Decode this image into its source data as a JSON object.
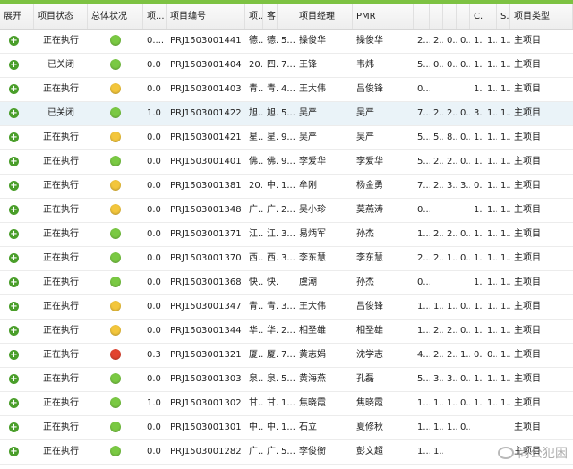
{
  "colors": {
    "top_bar": "#7dc242",
    "status_green": "#7ac943",
    "status_yellow": "#f3c63c",
    "status_red": "#e2432f",
    "expand_green": "#4a9e2a"
  },
  "columns": [
    "展开",
    "项目状态",
    "总体状况",
    "项...",
    "项目编号",
    "项...",
    "客...",
    "",
    "项目经理",
    "PMR",
    "",
    "",
    "",
    "",
    "C...",
    "",
    "S...",
    "项目类型"
  ],
  "rows": [
    {
      "status": "正在执行",
      "health": "green",
      "h": "0....",
      "code": "PRJ1503001441",
      "a": "德...",
      "b": "德...",
      "c": "5...",
      "mgr": "操俊华",
      "pmr": "操俊华",
      "d": "2...",
      "e": "2...",
      "f": "0...",
      "g": "0...",
      "h2": "1...",
      "i": "1...",
      "j": "1...",
      "type": "主项目"
    },
    {
      "status": "已关闭",
      "health": "green",
      "h": "0.0",
      "code": "PRJ1503001404",
      "a": "20...",
      "b": "四...",
      "c": "7...",
      "mgr": "王锋",
      "pmr": "韦炜",
      "d": "5...",
      "e": "0...",
      "f": "0...",
      "g": "0...",
      "h2": "1...",
      "i": "1...",
      "j": "1...",
      "type": "主项目"
    },
    {
      "status": "正在执行",
      "health": "yellow",
      "h": "0.0",
      "code": "PRJ1503001403",
      "a": "青...",
      "b": "青...",
      "c": "4...",
      "mgr": "王大伟",
      "pmr": "吕俊锋",
      "d": "0...",
      "e": "",
      "f": "",
      "g": "",
      "h2": "1...",
      "i": "1...",
      "j": "1...",
      "type": "主项目"
    },
    {
      "status": "已关闭",
      "health": "green",
      "h": "1.0",
      "code": "PRJ1503001422",
      "a": "旭...",
      "b": "旭...",
      "c": "5...",
      "mgr": "吴严",
      "pmr": "吴严",
      "d": "7...",
      "e": "2...",
      "f": "2...",
      "g": "0...",
      "h2": "3...",
      "i": "1...",
      "j": "1...",
      "type": "主项目",
      "sel": true
    },
    {
      "status": "正在执行",
      "health": "yellow",
      "h": "0.0",
      "code": "PRJ1503001421",
      "a": "星...",
      "b": "星...",
      "c": "9...",
      "mgr": "吴严",
      "pmr": "吴严",
      "d": "5...",
      "e": "5...",
      "f": "8...",
      "g": "0...",
      "h2": "1...",
      "i": "1...",
      "j": "1...",
      "type": "主项目"
    },
    {
      "status": "正在执行",
      "health": "green",
      "h": "0.0",
      "code": "PRJ1503001401",
      "a": "佛...",
      "b": "佛...",
      "c": "9...",
      "mgr": "李爱华",
      "pmr": "李爱华",
      "d": "5...",
      "e": "2...",
      "f": "2...",
      "g": "0...",
      "h2": "1...",
      "i": "1...",
      "j": "1...",
      "type": "主项目"
    },
    {
      "status": "正在执行",
      "health": "yellow",
      "h": "0.0",
      "code": "PRJ1503001381",
      "a": "20...",
      "b": "中...",
      "c": "1...",
      "mgr": "牟刚",
      "pmr": "杨金勇",
      "d": "7...",
      "e": "2...",
      "f": "3...",
      "g": "3...",
      "h2": "0...",
      "i": "1...",
      "j": "1...",
      "type": "主项目"
    },
    {
      "status": "正在执行",
      "health": "yellow",
      "h": "0.0",
      "code": "PRJ1503001348",
      "a": "广...",
      "b": "广...",
      "c": "2...",
      "mgr": "吴小珍",
      "pmr": "莫燕涛",
      "d": "0...",
      "e": "",
      "f": "",
      "g": "",
      "h2": "1...",
      "i": "1...",
      "j": "1...",
      "type": "主项目"
    },
    {
      "status": "正在执行",
      "health": "green",
      "h": "0.0",
      "code": "PRJ1503001371",
      "a": "江...",
      "b": "江...",
      "c": "3...",
      "mgr": "易炳军",
      "pmr": "孙杰",
      "d": "1...",
      "e": "2...",
      "f": "2...",
      "g": "0...",
      "h2": "1...",
      "i": "1...",
      "j": "1...",
      "type": "主项目"
    },
    {
      "status": "正在执行",
      "health": "green",
      "h": "0.0",
      "code": "PRJ1503001370",
      "a": "西...",
      "b": "西...",
      "c": "3...",
      "mgr": "李东慧",
      "pmr": "李东慧",
      "d": "2...",
      "e": "2...",
      "f": "1...",
      "g": "0...",
      "h2": "1...",
      "i": "1...",
      "j": "1...",
      "type": "主项目"
    },
    {
      "status": "正在执行",
      "health": "green",
      "h": "0.0",
      "code": "PRJ1503001368",
      "a": "快...",
      "b": "快...",
      "c": "",
      "mgr": "虞潮",
      "pmr": "孙杰",
      "d": "0...",
      "e": "",
      "f": "",
      "g": "",
      "h2": "1...",
      "i": "1...",
      "j": "1...",
      "type": "主项目"
    },
    {
      "status": "正在执行",
      "health": "yellow",
      "h": "0.0",
      "code": "PRJ1503001347",
      "a": "青...",
      "b": "青...",
      "c": "3...",
      "mgr": "王大伟",
      "pmr": "吕俊锋",
      "d": "1...",
      "e": "1...",
      "f": "1...",
      "g": "0...",
      "h2": "1...",
      "i": "1...",
      "j": "1...",
      "type": "主项目"
    },
    {
      "status": "正在执行",
      "health": "yellow",
      "h": "0.0",
      "code": "PRJ1503001344",
      "a": "华...",
      "b": "华...",
      "c": "2...",
      "mgr": "相圣雄",
      "pmr": "相圣雄",
      "d": "1...",
      "e": "2...",
      "f": "2...",
      "g": "0...",
      "h2": "1...",
      "i": "1...",
      "j": "1...",
      "type": "主项目"
    },
    {
      "status": "正在执行",
      "health": "red",
      "h": "0.3",
      "code": "PRJ1503001321",
      "a": "厦...",
      "b": "厦...",
      "c": "7...",
      "mgr": "黄志娟",
      "pmr": "沈学志",
      "d": "4...",
      "e": "2...",
      "f": "2...",
      "g": "1...",
      "h2": "0...",
      "i": "0...",
      "j": "1...",
      "type": "主项目"
    },
    {
      "status": "正在执行",
      "health": "green",
      "h": "0.0",
      "code": "PRJ1503001303",
      "a": "泉...",
      "b": "泉...",
      "c": "5...",
      "mgr": "黄海燕",
      "pmr": "孔磊",
      "d": "5...",
      "e": "3...",
      "f": "3...",
      "g": "0...",
      "h2": "1...",
      "i": "1...",
      "j": "1...",
      "type": "主项目"
    },
    {
      "status": "正在执行",
      "health": "green",
      "h": "1.0",
      "code": "PRJ1503001302",
      "a": "甘...",
      "b": "甘...",
      "c": "1...",
      "mgr": "焦晓霞",
      "pmr": "焦晓霞",
      "d": "1...",
      "e": "1...",
      "f": "1...",
      "g": "0...",
      "h2": "1...",
      "i": "1...",
      "j": "1...",
      "type": "主项目"
    },
    {
      "status": "正在执行",
      "health": "green",
      "h": "0.0",
      "code": "PRJ1503001301",
      "a": "中...",
      "b": "中...",
      "c": "1...",
      "mgr": "石立",
      "pmr": "夏修秋",
      "d": "1...",
      "e": "1...",
      "f": "1...",
      "g": "0...",
      "h2": "",
      "i": "",
      "j": "",
      "type": "主项目"
    },
    {
      "status": "正在执行",
      "health": "green",
      "h": "0.0",
      "code": "PRJ1503001282",
      "a": "广...",
      "b": "广...",
      "c": "5...",
      "mgr": "李俊衡",
      "pmr": "彭文超",
      "d": "1...",
      "e": "1...",
      "f": "",
      "g": "",
      "h2": "",
      "i": "",
      "j": "",
      "type": "主项目"
    }
  ],
  "watermark": "尚公犯困"
}
